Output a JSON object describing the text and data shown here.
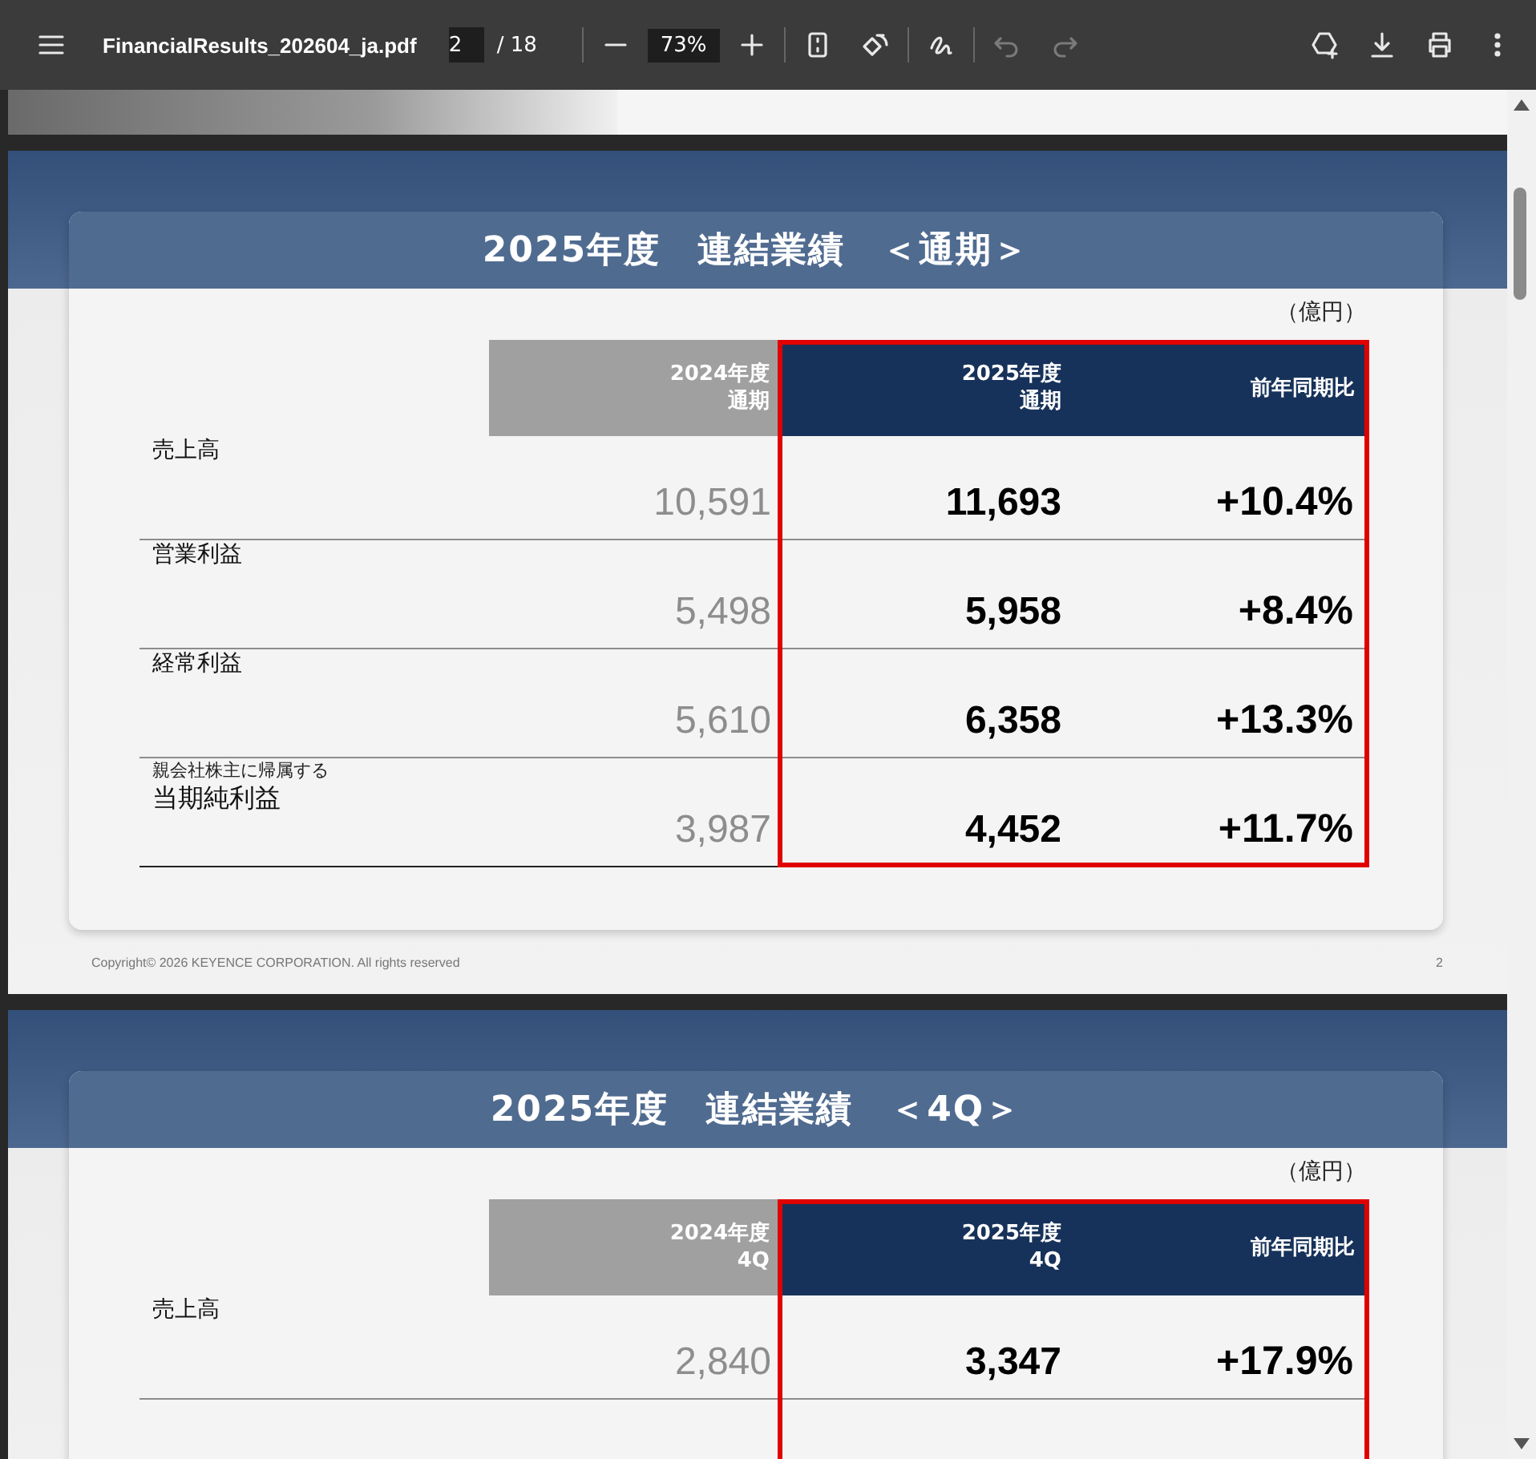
{
  "toolbar": {
    "file_name": "FinancialResults_202604_ja.pdf",
    "page_number": "2",
    "page_total": "/ 18",
    "zoom": "73%",
    "undo_disabled": true,
    "redo_disabled": true
  },
  "slides": [
    {
      "title": "2025年度　連結業績　＜通期＞",
      "unit": "（億円）",
      "highlight_box": true,
      "continues": false,
      "columns": [
        {
          "line_1": "2024年度",
          "line_2": "通期",
          "kind": "previous"
        },
        {
          "line_1": "2025年度",
          "line_2": "通期",
          "kind": "current"
        },
        {
          "line_1": "前年同期比",
          "kind": "change"
        }
      ],
      "rows": [
        {
          "label": "売上高",
          "previous": "10,591",
          "current": "11,693",
          "change": "+10.4%"
        },
        {
          "label": "営業利益",
          "previous": "5,498",
          "current": "5,958",
          "change": "+8.4%"
        },
        {
          "label": "経常利益",
          "previous": "5,610",
          "current": "6,358",
          "change": "+13.3%"
        },
        {
          "sublabel": "親会社株主に帰属する",
          "label": "当期純利益",
          "previous": "3,987",
          "current": "4,452",
          "change": "+11.7%"
        }
      ],
      "copyright": "Copyright© 2026 KEYENCE CORPORATION. All rights reserved",
      "page_number": "2"
    },
    {
      "title": "2025年度　連結業績　＜4Q＞",
      "unit": "（億円）",
      "highlight_box": true,
      "continues": true,
      "columns": [
        {
          "line_1": "2024年度",
          "line_2": "4Q",
          "kind": "previous"
        },
        {
          "line_1": "2025年度",
          "line_2": "4Q",
          "kind": "current"
        },
        {
          "line_1": "前年同期比",
          "kind": "change"
        }
      ],
      "rows": [
        {
          "label": "売上高",
          "previous": "2,840",
          "current": "3,347",
          "change": "+17.9%"
        }
      ]
    }
  ]
}
